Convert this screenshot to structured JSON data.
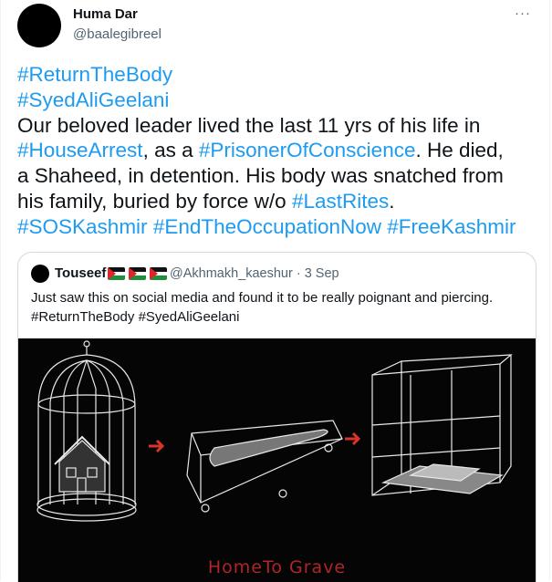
{
  "author": {
    "name": "Huma Dar",
    "handle": "@baalegibreel"
  },
  "more_icon": "···",
  "tweet": {
    "lines": [
      [
        {
          "t": "#ReturnTheBody",
          "tag": true
        }
      ],
      [
        {
          "t": "#SyedAliGeelani",
          "tag": true
        }
      ],
      [
        {
          "t": "Our beloved leader lived the last 11 yrs of his life in",
          "tag": false
        }
      ],
      [
        {
          "t": "#HouseArrest",
          "tag": true
        },
        {
          "t": ", as a ",
          "tag": false
        },
        {
          "t": "#PrisonerOfConscience",
          "tag": true
        },
        {
          "t": ".  He died,",
          "tag": false
        }
      ],
      [
        {
          "t": "a Shaheed, in detention. His body was snatched from",
          "tag": false
        }
      ],
      [
        {
          "t": "his family, buried by force w/o ",
          "tag": false
        },
        {
          "t": "#LastRites",
          "tag": true
        },
        {
          "t": ".",
          "tag": false
        }
      ],
      [
        {
          "t": "#SOSKashmir",
          "tag": true
        },
        {
          "t": " ",
          "tag": false
        },
        {
          "t": "#EndTheOccupationNow",
          "tag": true
        },
        {
          "t": " ",
          "tag": false
        },
        {
          "t": "#FreeKashmir",
          "tag": true
        }
      ]
    ]
  },
  "quote": {
    "name": "Touseef",
    "flags": [
      "palestine-flag-icon",
      "palestine-flag-icon",
      "palestine-flag-icon"
    ],
    "meta": "@Akhmakh_kaeshur · 3 Sep",
    "text_line1": "Just saw this on social media and found it to be really poignant and piercing.",
    "text_line2": "#ReturnTheBody #SyedAliGeelani",
    "media_caption": "HomeTo Grave"
  },
  "colors": {
    "link": "#1d9bf0",
    "muted": "#536471",
    "border": "#cfd9de",
    "arrow": "#d9342b"
  }
}
